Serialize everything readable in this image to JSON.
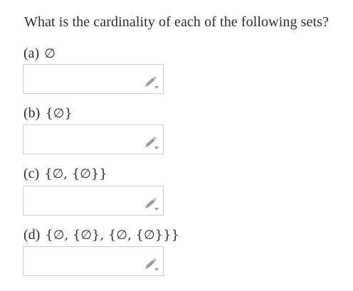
{
  "question": {
    "text": "What is the cardinality of each of the following sets?"
  },
  "parts": [
    {
      "letter": "(a)",
      "set": "∅",
      "answer": ""
    },
    {
      "letter": "(b)",
      "set": "{∅}",
      "answer": ""
    },
    {
      "letter": "(c)",
      "set": "{∅, {∅}}",
      "answer": ""
    },
    {
      "letter": "(d)",
      "set": "{∅, {∅}, {∅, {∅}}}",
      "answer": ""
    }
  ],
  "icons": {
    "edit": "pencil-icon"
  },
  "colors": {
    "text": "#2d2d2d",
    "box_border": "#cfcfcf",
    "icon": "#9a9a9a"
  }
}
